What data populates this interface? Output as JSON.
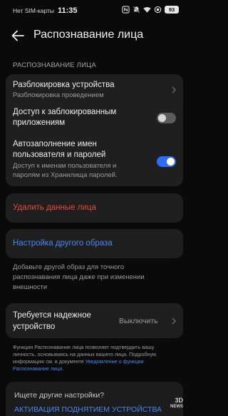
{
  "status_bar": {
    "carrier": "Нет SIM-карты",
    "time": "11:35",
    "battery": "93"
  },
  "header": {
    "title": "Распознавание лица"
  },
  "section": {
    "label": "РАСПОЗНАВАНИЕ ЛИЦА"
  },
  "settings": {
    "unlock": {
      "title": "Разблокировка устройства",
      "subtitle": "Разблокировка проведением"
    },
    "locked_apps": {
      "title_line1": "Доступ к заблокированным",
      "title_line2": "приложениям",
      "enabled": false
    },
    "autofill": {
      "title_line1": "Автозаполнение имен",
      "title_line2": "пользователя и паролей",
      "subtitle_line1": "Доступ к именам пользователя и",
      "subtitle_line2": "паролям из Хранилища паролей.",
      "enabled": true
    }
  },
  "delete_face": {
    "label": "Удалить данные лица",
    "color": "#e5473d"
  },
  "alt_appearance": {
    "label": "Настройка другого образа",
    "color": "#4a86f5",
    "description_line1": "Добавьте другой образ для точного",
    "description_line2": "распознавания лица даже при изменении",
    "description_line3": "внешности"
  },
  "trusted_device": {
    "title_line1": "Требуется надежное",
    "title_line2": "устройство",
    "value": "Выключить"
  },
  "footnote": {
    "line1": "Функция Распознавание лица позволяет подтвердить вашу",
    "line2": "личность, основываясь на данных вашего лица. Подробную",
    "line3_prefix": "информацию см. в документе ",
    "link_part1": "Уведомление о функции",
    "link_part2": "Распознавание лица",
    "suffix": "."
  },
  "bottom": {
    "question": "Ищете другие настройки?",
    "link": "АКТИВАЦИЯ ПОДНЯТИЕМ УСТРОЙСТВА"
  },
  "watermark": {
    "line1": "3D",
    "line2": "NEWS"
  }
}
